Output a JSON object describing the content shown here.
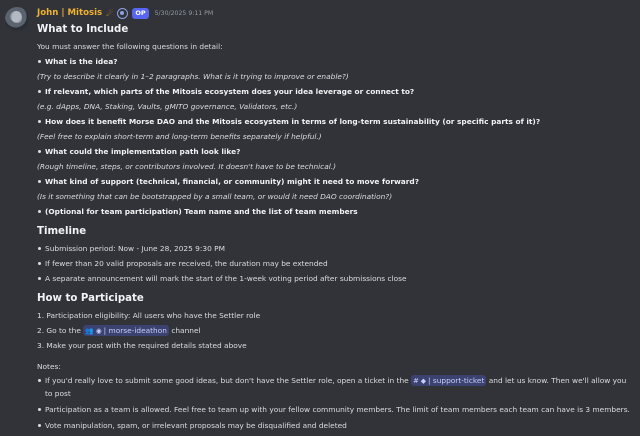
{
  "message": {
    "author": "John | Mitosis",
    "tag": "OP",
    "timestamp": "5/30/2025 9:11 PM"
  },
  "include": {
    "heading": "What to Include",
    "intro": "You must answer the following questions in detail:",
    "q1": "What is the idea?",
    "q1_note": "(Try to describe it clearly in 1–2 paragraphs. What is it trying to improve or enable?)",
    "q2": "If relevant, which parts of the Mitosis ecosystem does your idea leverage or connect to?",
    "q2_note": "(e.g. dApps, DNA, Staking, Vaults, gMITO governance, Validators, etc.)",
    "q3": "How does it benefit Morse DAO and the Mitosis ecosystem in terms of long-term sustainability (or specific parts of it)?",
    "q3_note": "(Feel free to explain short-term and long-term benefits separately if helpful.)",
    "q4": "What could the implementation path look like?",
    "q4_note": "(Rough timeline, steps, or contributors involved. It doesn't have to be technical.)",
    "q5": "What kind of support (technical, financial, or community) might it need to move forward?",
    "q5_note": "(Is it something that can be bootstrapped by a small team, or would it need DAO coordination?)",
    "q6": "(Optional for team participation) Team name and the list of team members"
  },
  "timeline": {
    "heading": "Timeline",
    "item1": "Submission period: Now - June 28, 2025 9:30 PM",
    "item2": "If fewer than 20 valid proposals are received, the duration may be extended",
    "item3": "A separate announcement will mark the start of the 1-week voting period after submissions close"
  },
  "participate": {
    "heading": "How to Participate",
    "step1": "1. Participation eligibility: All users who have the Settler role",
    "step2_prefix": "2. Go to the",
    "step2_channel": "| morse-ideathon",
    "step2_suffix": "channel",
    "step3": "3. Make your post with the required details stated above"
  },
  "notes": {
    "label": "Notes:",
    "n1_prefix": "If you'd really love to submit some good ideas, but don't have the Settler role, open a ticket in the",
    "n1_channel": "| support-ticket",
    "n1_suffix": "and let us know. Then we'll allow you",
    "n1_cont": "to post",
    "n2": "Participation as a team is allowed. Feel free to team up with your fellow community members. The limit of team members each team can have is 3 members.",
    "n3": "Vote manipulation, spam, or irrelevant proposals may be disqualified and deleted"
  },
  "icons": {
    "author_badge_1": "rocket-emoji",
    "author_badge_2": "ring-badge",
    "ideathon_icons": [
      "group-emoji",
      "brain-emoji"
    ],
    "ticket_icons": [
      "hash-icon",
      "ticket-emoji"
    ]
  },
  "colors": {
    "background": "#313338",
    "username": "#f0b232",
    "op_tag": "#5865f2",
    "mention_bg": "#3c4270",
    "mention_text": "#c9cdfb"
  }
}
